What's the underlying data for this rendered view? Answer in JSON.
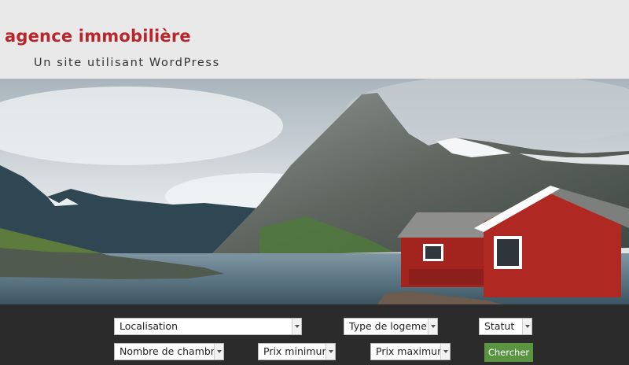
{
  "header": {
    "site_title": "agence immobilière",
    "tagline": "Un site utilisant WordPress"
  },
  "hero": {
    "image_description_icon": "landscape-image"
  },
  "search": {
    "location": "Localisation",
    "type": "Type de logement",
    "status": "Statut",
    "bedrooms": "Nombre de chambres",
    "min_price": "Prix minimum",
    "max_price": "Prix maximum",
    "submit_label": "Chercher"
  },
  "colors": {
    "title": "#b8262b",
    "header_bg": "#e9e9e9",
    "search_bg": "#2b2b2b",
    "button": "#5a9440"
  }
}
